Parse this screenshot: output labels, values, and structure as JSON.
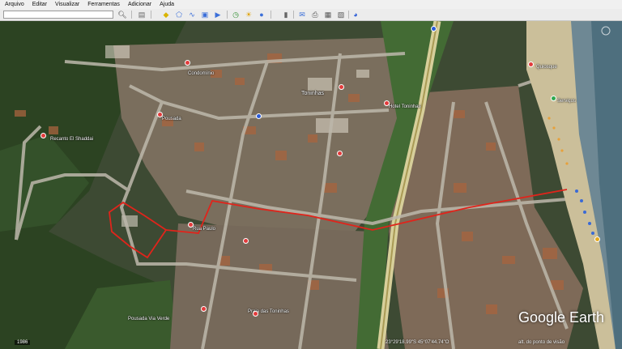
{
  "menu": [
    "Arquivo",
    "Editar",
    "Visualizar",
    "Ferramentas",
    "Adicionar",
    "Ajuda"
  ],
  "toolbar": {
    "search_value": "",
    "buttons": [
      "search-icon",
      "sidebar-icon",
      "placemark-icon",
      "polygon-icon",
      "path-icon",
      "overlay-icon",
      "tour-icon",
      "history-icon",
      "sun-icon",
      "planets-icon",
      "ruler-icon",
      "email-icon",
      "print-icon",
      "save-image-icon",
      "maps-icon"
    ]
  },
  "map": {
    "labels": {
      "toninhas": "Toninhas",
      "hotel_toninhas": "Hotel Toninhas",
      "pousada_via_verde": "Pousada Via Verde",
      "residencial": "Recanto El Shaddai",
      "condominio": "Condomínio",
      "rua_paulo": "Rua Paulo",
      "pousada": "Pousada",
      "quiosque": "Quiosque",
      "servicos": "Serviços",
      "toninhas_beach": "Praia das Toninhas"
    }
  },
  "logo": "Google Earth",
  "status": {
    "year": "1986",
    "coords": "23°29'18.99\"S  45°07'44.74\"O",
    "alt": "alt. do ponto de visão"
  },
  "colors": {
    "route": "#e0241b",
    "pin_red": "#e23b3b",
    "pin_blue": "#2a5bd7",
    "pin_green": "#2fa84f"
  }
}
